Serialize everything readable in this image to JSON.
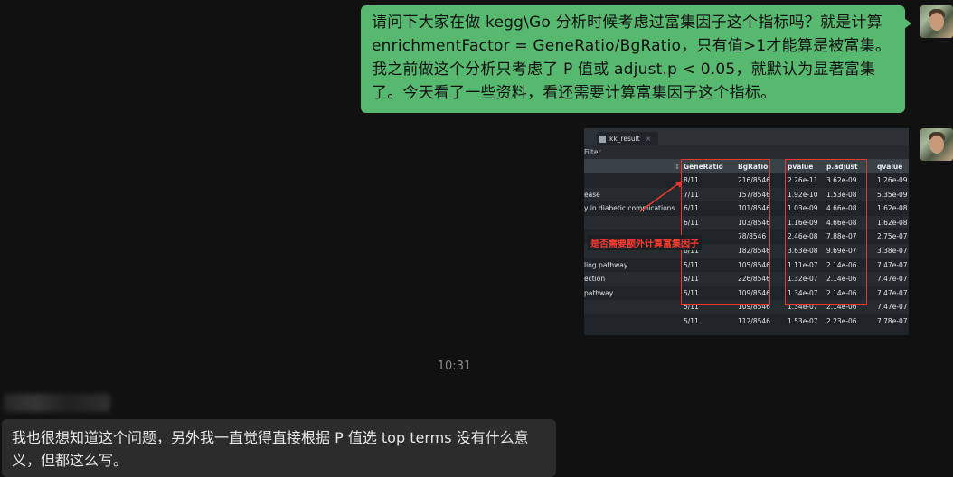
{
  "messages": {
    "outgoing": {
      "text": "请问下大家在做 kegg\\Go 分析时候考虑过富集因子这个指标吗？就是计算 enrichmentFactor = GeneRatio/BgRatio，只有值>1才能算是被富集。我之前做这个分析只考虑了 P 值或 adjust.p < 0.05，就默认为显著富集了。今天看了一些资料，看还需要计算富集因子这个指标。"
    },
    "timestamp": "10:31",
    "incoming": {
      "text": "我也很想知道这个问题，另外我一直觉得直接根据 P 值选 top terms 没有什么意义，但都这么写。"
    }
  },
  "screenshot": {
    "tab_label": "kk_result",
    "tab_close": "×",
    "filter_label": "Filter",
    "annotation": "是否需要额外计算富集因子",
    "columns": [
      "",
      "GeneRatio",
      "BgRatio",
      "pvalue",
      "p.adjust",
      "qvalue"
    ],
    "rows": [
      [
        "",
        "8/11",
        "216/8546",
        "2.26e-11",
        "3.62e-09",
        "1.26e-09"
      ],
      [
        "ease",
        "7/11",
        "157/8546",
        "1.92e-10",
        "1.53e-08",
        "5.35e-09"
      ],
      [
        "y in diabetic complications",
        "6/11",
        "101/8546",
        "1.03e-09",
        "4.66e-08",
        "1.62e-08"
      ],
      [
        "",
        "6/11",
        "103/8546",
        "1.16e-09",
        "4.66e-08",
        "1.62e-08"
      ],
      [
        "",
        "",
        "78/8546",
        "2.46e-08",
        "7.88e-07",
        "2.75e-07"
      ],
      [
        "",
        "6/11",
        "182/8546",
        "3.63e-08",
        "9.69e-07",
        "3.38e-07"
      ],
      [
        "ling pathway",
        "5/11",
        "105/8546",
        "1.11e-07",
        "2.14e-06",
        "7.47e-07"
      ],
      [
        "ection",
        "6/11",
        "226/8546",
        "1.32e-07",
        "2.14e-06",
        "7.47e-07"
      ],
      [
        "pathway",
        "5/11",
        "109/8546",
        "1.34e-07",
        "2.14e-06",
        "7.47e-07"
      ],
      [
        "",
        "5/11",
        "109/8546",
        "1.34e-07",
        "2.14e-06",
        "7.47e-07"
      ],
      [
        "",
        "5/11",
        "112/8546",
        "1.53e-07",
        "2.23e-06",
        "7.78e-07"
      ]
    ]
  }
}
